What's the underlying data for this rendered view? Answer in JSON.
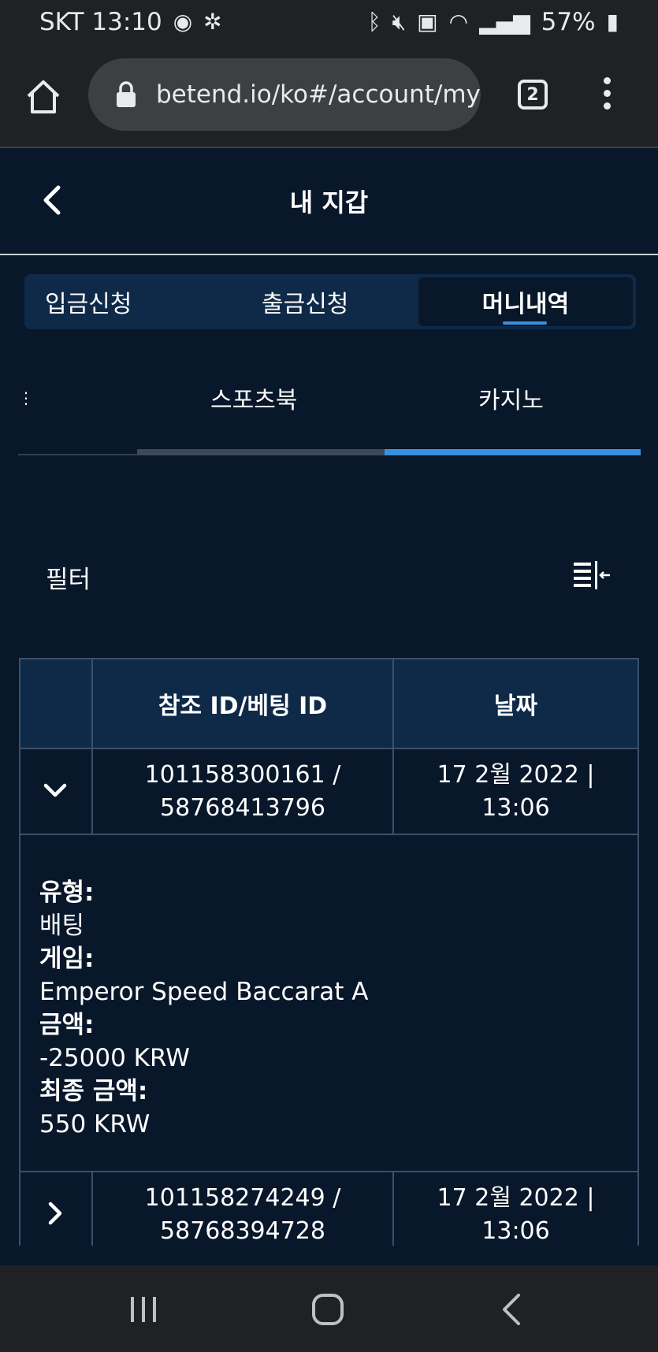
{
  "status_bar": {
    "carrier_time": "SKT 13:10",
    "battery": "57%"
  },
  "browser": {
    "url": "betend.io/ko#/account/my",
    "tabs_count": "2"
  },
  "page": {
    "title": "내 지갑"
  },
  "top_tabs": [
    {
      "label": "입금신청",
      "active": false
    },
    {
      "label": "출금신청",
      "active": false
    },
    {
      "label": "머니내역",
      "active": true
    }
  ],
  "sub_tabs": [
    {
      "label": "스포츠북",
      "active": false
    },
    {
      "label": "카지노",
      "active": true
    }
  ],
  "filter": {
    "label": "필터"
  },
  "table": {
    "headers": [
      "참조 ID/베팅 ID",
      "날짜"
    ],
    "rows": [
      {
        "ref_line1": "101158300161 /",
        "ref_line2": "58768413796",
        "date_line1": "17 2월 2022 |",
        "date_line2": "13:06",
        "expanded": true,
        "details": {
          "type_label": "유형:",
          "type_value": "배팅",
          "game_label": "게임:",
          "game_value": "Emperor Speed Baccarat A",
          "amount_label": "금액:",
          "amount_value": "-25000 KRW",
          "final_label": "최종 금액:",
          "final_value": "550 KRW"
        }
      },
      {
        "ref_line1": "101158274249 /",
        "ref_line2": "58768394728",
        "date_line1": "17 2월 2022 |",
        "date_line2": "13:06",
        "expanded": false
      }
    ]
  },
  "colors": {
    "background": "#08172a",
    "header_bg": "#0f2a48",
    "accent": "#3b8fe0"
  }
}
